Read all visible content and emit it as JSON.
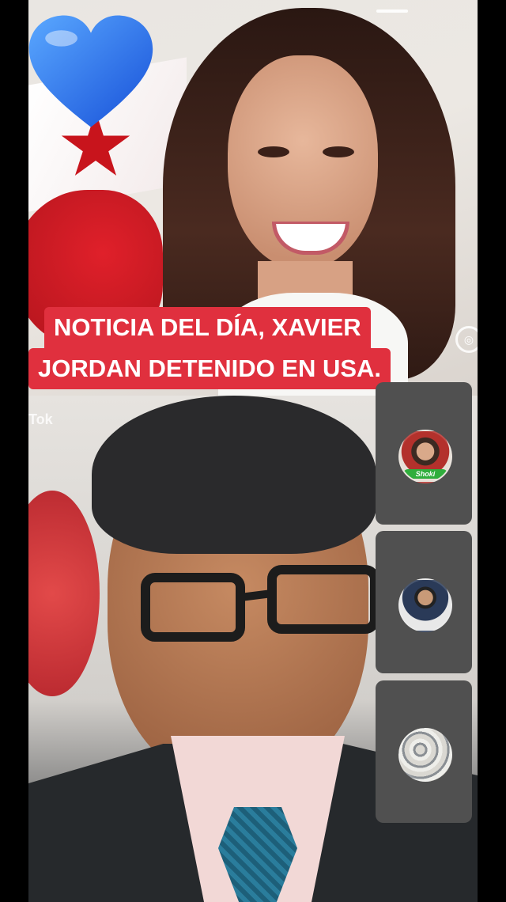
{
  "headline": {
    "line1": "NOTICIA DEL DÍA,  XAVIER",
    "line2": "JORDAN DETENIDO EN USA."
  },
  "watermark": "Tok",
  "guests": [
    {
      "id": "guest-1",
      "badge": "Shoki"
    },
    {
      "id": "guest-2"
    },
    {
      "id": "guest-3"
    }
  ],
  "icons": {
    "heart": "blue-heart-icon",
    "side": "ring-icon"
  },
  "colors": {
    "headline_bg": "#e0303e",
    "headline_text": "#ffffff",
    "tile_bg": "#505050",
    "badge_bg": "#2fae3c"
  }
}
